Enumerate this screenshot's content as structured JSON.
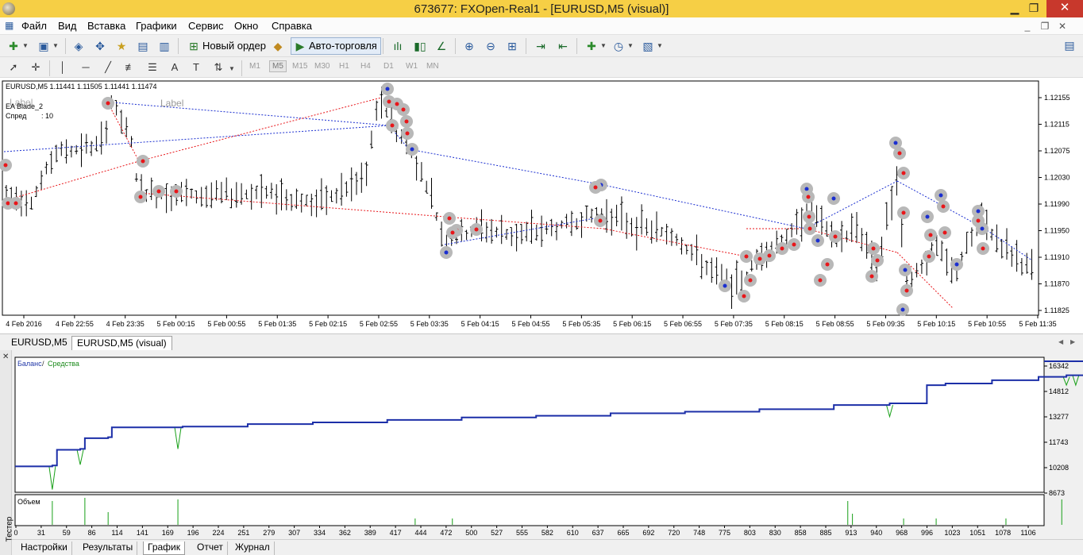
{
  "window": {
    "title": "673677: FXOpen-Real1 - [EURUSD,M5 (visual)]",
    "min": "▁",
    "max": "❐",
    "close": "✕"
  },
  "menu": {
    "items": [
      "Файл",
      "Вид",
      "Вставка",
      "Графики",
      "Сервис",
      "Окно",
      "Справка"
    ],
    "mdi": [
      "_",
      "❐",
      "✕"
    ]
  },
  "toolbar": {
    "new_order": "Новый ордер",
    "auto_trading": "Авто-торговля",
    "search_icon": "⚲"
  },
  "periods": [
    "M1",
    "M5",
    "M15",
    "M30",
    "H1",
    "H4",
    "D1",
    "W1",
    "MN"
  ],
  "selected_period": "M5",
  "chart": {
    "symbol_info": "EURUSD,M5  1.11441 1.11505 1.11441 1.11474",
    "ea_name": "EA Blade_2",
    "spread_label": "Спред",
    "spread_value": ":   10",
    "ghost_label_1": "Label",
    "ghost_label_2": "Label",
    "price_ticks": [
      "1.12155",
      "1.12115",
      "1.12075",
      "1.12030",
      "1.11990",
      "1.11950",
      "1.11910",
      "1.11870",
      "1.11825"
    ],
    "time_ticks": [
      "4 Feb 2016",
      "4 Feb 22:55",
      "4 Feb 23:35",
      "5 Feb 00:15",
      "5 Feb 00:55",
      "5 Feb 01:35",
      "5 Feb 02:15",
      "5 Feb 02:55",
      "5 Feb 03:35",
      "5 Feb 04:15",
      "5 Feb 04:55",
      "5 Feb 05:35",
      "5 Feb 06:15",
      "5 Feb 06:55",
      "5 Feb 07:35",
      "5 Feb 08:15",
      "5 Feb 08:55",
      "5 Feb 09:35",
      "5 Feb 10:15",
      "5 Feb 10:55",
      "5 Feb 11:35"
    ],
    "colors": {
      "bars": "#000000",
      "buy": "#1b2fd0",
      "sell": "#e8161a",
      "marker_halo": "#b8b8b8"
    }
  },
  "chart_tabs": [
    "EURUSD,M5",
    "EURUSD,M5 (visual)"
  ],
  "active_chart_tab": "EURUSD,M5 (visual)",
  "tester": {
    "side_label": "Тестер",
    "balance_label": "Баланс",
    "separator": "/",
    "equity_label": "Средства",
    "volume_label": "Объем",
    "y_ticks": [
      "16342",
      "14812",
      "13277",
      "11743",
      "10208",
      "8673"
    ],
    "x_ticks": [
      "0",
      "31",
      "59",
      "86",
      "114",
      "141",
      "169",
      "196",
      "224",
      "251",
      "279",
      "307",
      "334",
      "362",
      "389",
      "417",
      "444",
      "472",
      "500",
      "527",
      "555",
      "582",
      "610",
      "637",
      "665",
      "692",
      "720",
      "748",
      "775",
      "803",
      "830",
      "858",
      "885",
      "913",
      "940",
      "968",
      "996",
      "1023",
      "1051",
      "1078",
      "1106"
    ],
    "colors": {
      "balance": "#1c2fa8",
      "equity": "#18a018",
      "volume": "#18a018"
    }
  },
  "bottom_tabs": [
    "Настройки",
    "Результаты",
    "График",
    "Отчет",
    "Журнал"
  ],
  "active_bottom_tab": "График",
  "chart_data": [
    {
      "type": "line",
      "title": "",
      "series": [
        {
          "name": "Баланс",
          "x": [
            0,
            40,
            45,
            70,
            75,
            100,
            104,
            180,
            250,
            320,
            400,
            480,
            560,
            640,
            720,
            800,
            880,
            940,
            950,
            980,
            1000,
            1050,
            1100,
            1130,
            1150,
            1200,
            1220,
            1230,
            1260,
            1290
          ],
          "values": [
            10000,
            10050,
            11000,
            11050,
            11700,
            11760,
            12350,
            12400,
            12550,
            12650,
            12800,
            12950,
            13050,
            13200,
            13300,
            13450,
            13700,
            13800,
            13800,
            14900,
            15000,
            15200,
            15400,
            15500,
            15600,
            15700,
            15800,
            16100,
            16200,
            16342
          ]
        }
      ],
      "ylim": [
        8673,
        16342
      ],
      "xlim": [
        0,
        1106
      ]
    }
  ]
}
